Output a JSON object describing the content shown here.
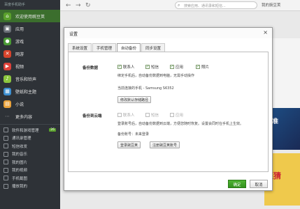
{
  "sidebar": {
    "logo_text": "百度手机助手",
    "nav": [
      {
        "label": "欢迎使用豌豆荚",
        "icon": "home-icon",
        "active": true
      },
      {
        "label": "应用",
        "icon": "app-icon"
      },
      {
        "label": "游戏",
        "icon": "game-icon"
      },
      {
        "label": "网游",
        "icon": "netgame-icon"
      },
      {
        "label": "视频",
        "icon": "video-icon"
      },
      {
        "label": "音乐和铃声",
        "icon": "music-icon"
      },
      {
        "label": "壁纸和主题",
        "icon": "wallpaper-icon"
      },
      {
        "label": "小说",
        "icon": "book-icon"
      },
      {
        "label": "更多内容",
        "icon": "more-icon"
      }
    ],
    "sub": [
      {
        "label": "软件和游戏管理",
        "badge": "26"
      },
      {
        "label": "通讯录管理"
      },
      {
        "label": "短信收发"
      },
      {
        "label": "我的音乐"
      },
      {
        "label": "我的图片"
      },
      {
        "label": "我的视频"
      },
      {
        "label": "手机截图"
      },
      {
        "label": "播放我的"
      }
    ]
  },
  "topbar": {
    "search_placeholder": "搜索应用、通讯录和短信...",
    "right_text": "我的豌豆荚"
  },
  "bg": {
    "promo2": "标准",
    "promo3": "旺猜"
  },
  "dialog": {
    "title": "设置",
    "close": "×",
    "tabs": [
      "系统设置",
      "手机管理",
      "自动备份",
      "同步设置"
    ],
    "backup": {
      "label": "备份数据",
      "items": [
        {
          "label": "联系人",
          "checked": true
        },
        {
          "label": "短信",
          "checked": true
        },
        {
          "label": "应用",
          "checked": true
        },
        {
          "label": "照片",
          "checked": true
        }
      ],
      "desc": "绑定手机后，自动备份数据到电脑，无需手动操作",
      "device": "当前连接的手机 - Samsung S6352",
      "change_btn": "修改默认存储路径"
    },
    "cloud": {
      "label": "备份到云端",
      "items": [
        {
          "label": "联系人"
        },
        {
          "label": "短信"
        },
        {
          "label": "应用"
        }
      ],
      "desc": "登录账号后，自动备份数据到云端，方便您随时恢复。设置会同时在手机上生效。",
      "account": "备份账号：未来登录",
      "login_btn": "登录豌豆荚",
      "register_btn": "注册豌豆荚账号"
    },
    "ok": "确定",
    "cancel": "取消"
  },
  "colors": {
    "accent": "#3b9a26",
    "sidebar_bg": "#2e3237"
  }
}
